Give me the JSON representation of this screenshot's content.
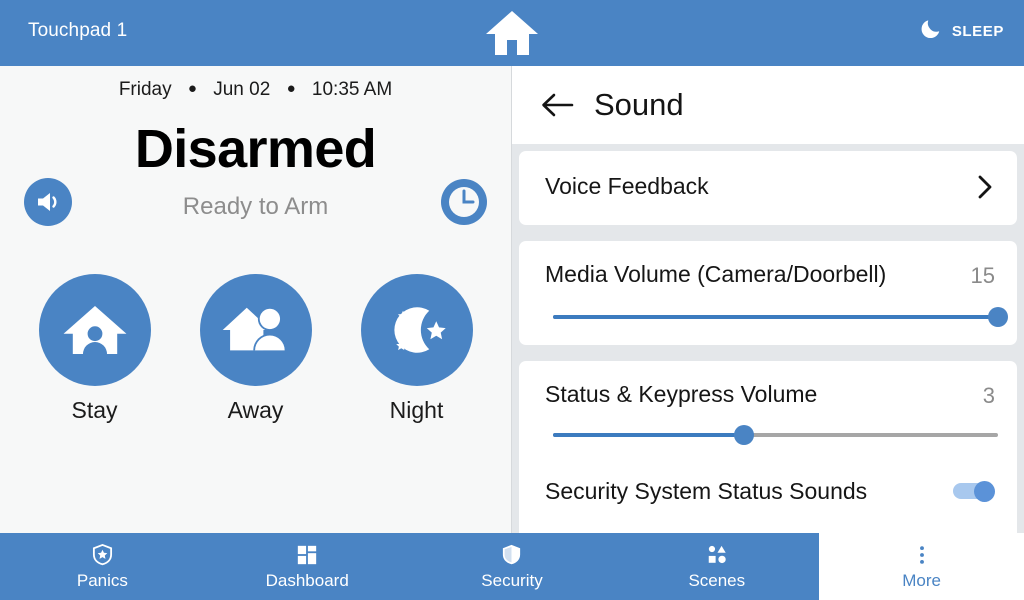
{
  "header": {
    "title": "Touchpad 1",
    "home_icon": "home-icon",
    "sleep_label": "SLEEP",
    "sleep_icon": "moon-icon",
    "background_color": "#4a84c4"
  },
  "left_panel": {
    "day": "Friday",
    "separator": "●",
    "date": "Jun 02",
    "time": "10:35 AM",
    "status": "Disarmed",
    "status_sub": "Ready to Arm",
    "speaker_icon": "speaker-icon",
    "clock_icon": "clock-icon",
    "modes": [
      {
        "label": "Stay",
        "icon": "house-person-icon"
      },
      {
        "label": "Away",
        "icon": "house-walking-person-icon"
      },
      {
        "label": "Night",
        "icon": "moon-stars-icon"
      }
    ]
  },
  "sound_panel": {
    "title": "Sound",
    "back_icon": "back-arrow-icon",
    "voice_feedback": {
      "label": "Voice Feedback",
      "chevron_icon": "chevron-right-icon"
    },
    "media_volume": {
      "label": "Media Volume (Camera/Doorbell)",
      "value": "15",
      "percent": 100
    },
    "status_keypress_volume": {
      "label": "Status & Keypress Volume",
      "value": "3",
      "percent": 43
    },
    "status_sounds": {
      "label": "Security System Status Sounds",
      "state": "on"
    },
    "accent_color": "#4a84c4"
  },
  "bottom_nav": {
    "items": [
      {
        "label": "Panics",
        "icon": "shield-star-icon",
        "active": false
      },
      {
        "label": "Dashboard",
        "icon": "grid-icon",
        "active": false
      },
      {
        "label": "Security",
        "icon": "shield-icon",
        "active": false
      },
      {
        "label": "Scenes",
        "icon": "shapes-icon",
        "active": false
      },
      {
        "label": "More",
        "icon": "more-vertical-icon",
        "active": true
      }
    ]
  }
}
